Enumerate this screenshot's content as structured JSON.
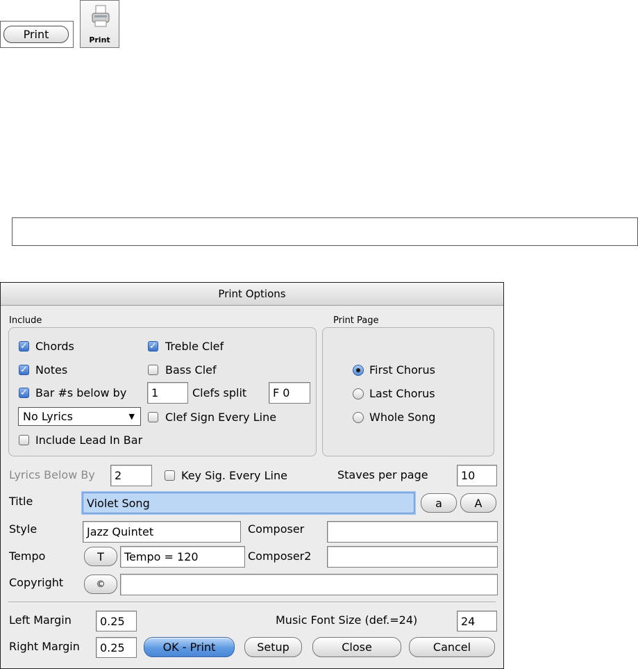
{
  "toolbar": {
    "print_button_label": "Print",
    "print_icon_label": "Print"
  },
  "dialog": {
    "title": "Print Options",
    "include": {
      "label": "Include",
      "chords": "Chords",
      "notes": "Notes",
      "bars_below_by": "Bar #s below by",
      "bars_below_value": "1",
      "lyrics_select": "No Lyrics",
      "include_lead_in": "Include Lead In Bar",
      "treble_clef": "Treble Clef",
      "bass_clef": "Bass Clef",
      "clefs_split": "Clefs split",
      "clefs_split_value": "F 0",
      "clef_sign_every_line": "Clef Sign Every Line"
    },
    "print_page": {
      "label": "Print Page",
      "options": [
        "First Chorus",
        "Last Chorus",
        "Whole Song"
      ],
      "selected": "First Chorus"
    },
    "lyrics_below_by": "Lyrics Below By",
    "lyrics_below_value": "2",
    "key_sig_every_line": "Key Sig. Every Line",
    "staves_per_page": "Staves per page",
    "staves_per_page_value": "10",
    "title_label": "Title",
    "title_value": "Violet Song",
    "lower_btn": "a",
    "upper_btn": "A",
    "style_label": "Style",
    "style_value": "Jazz Quintet",
    "composer_label": "Composer",
    "composer_value": "",
    "tempo_label": "Tempo",
    "tempo_btn": "T",
    "tempo_value": "Tempo = 120",
    "composer2_label": "Composer2",
    "composer2_value": "",
    "copyright_label": "Copyright",
    "copyright_btn": "©",
    "copyright_value": "",
    "left_margin_label": "Left Margin",
    "left_margin_value": "0.25",
    "right_margin_label": "Right Margin",
    "right_margin_value": "0.25",
    "music_font_size_label": "Music Font Size (def.=24)",
    "music_font_size_value": "24",
    "ok_print": "OK - Print",
    "setup": "Setup",
    "close": "Close",
    "cancel": "Cancel"
  }
}
